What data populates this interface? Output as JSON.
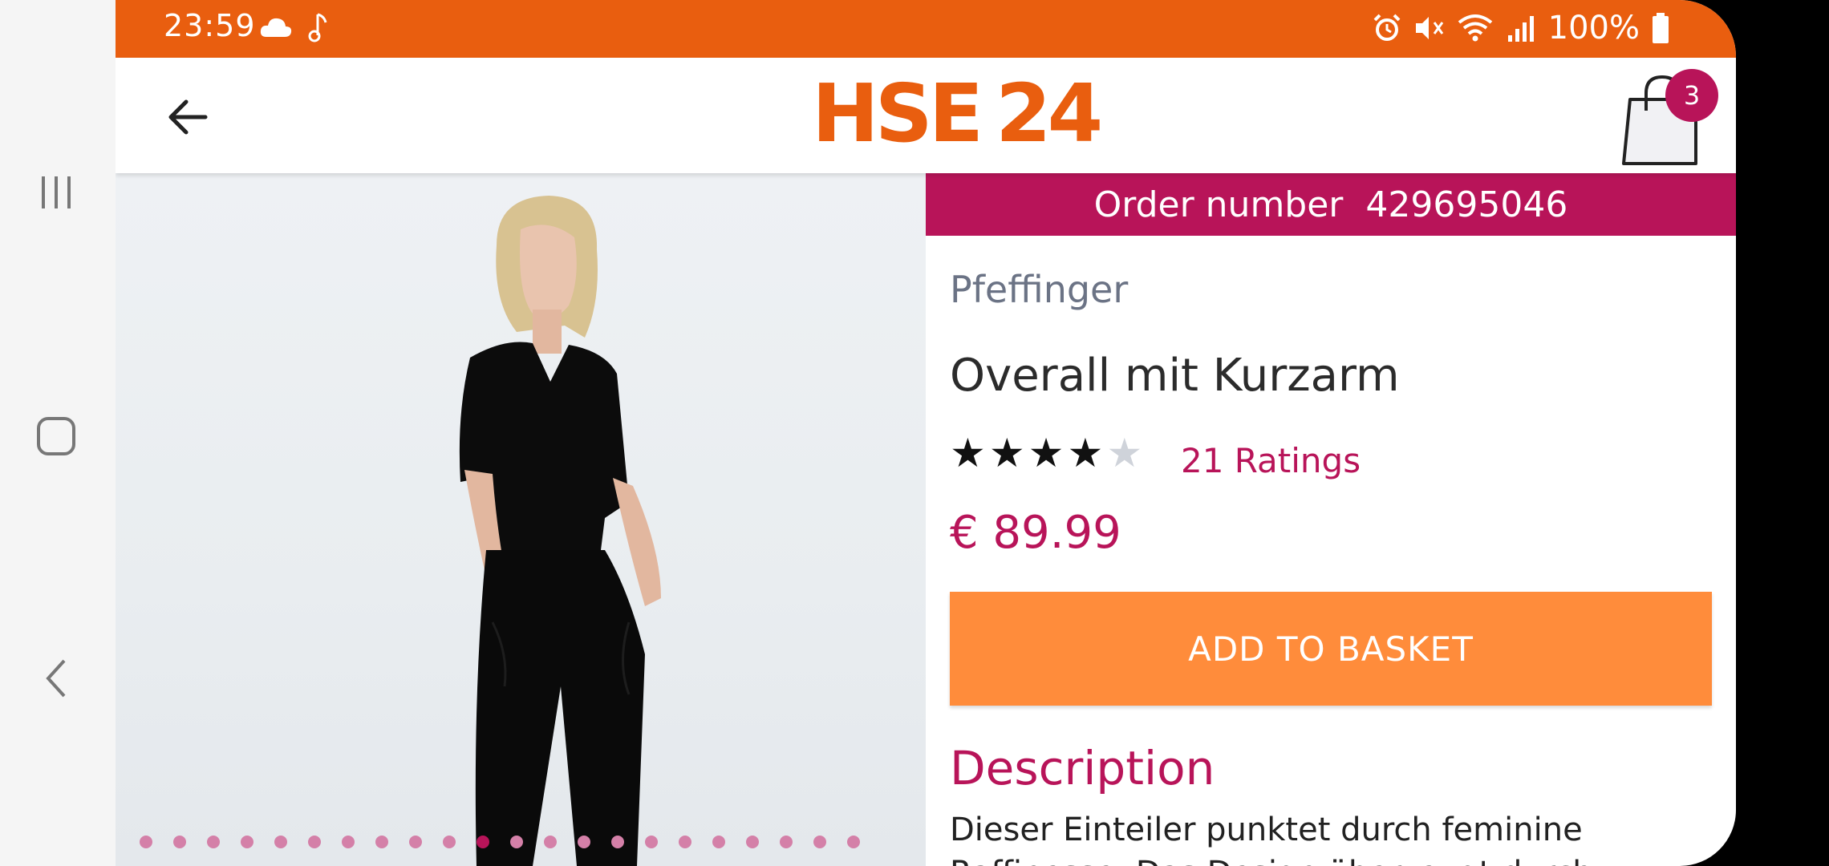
{
  "status_bar": {
    "time": "23:59",
    "battery": "100%"
  },
  "app_bar": {
    "logo_text_1": "HSE",
    "logo_text_2": "24",
    "basket_count": "3"
  },
  "product": {
    "order_label": "Order number",
    "order_number": "429695046",
    "brand": "Pfeffinger",
    "title": "Overall mit Kurzarm",
    "rating_stars": 4,
    "rating_max": 5,
    "ratings_text": "21 Ratings",
    "price": "€ 89.99",
    "add_to_basket": "ADD TO BASKET",
    "description_heading": "Description",
    "description_text": "Dieser Einteiler punktet durch feminine Raffinesse. Das Design überzeugt durch"
  },
  "gallery": {
    "total_images": 22,
    "active_index": 10
  },
  "colors": {
    "brand_orange": "#e95e0f",
    "accent_magenta": "#b81459",
    "button_orange": "#ff8c3b"
  }
}
